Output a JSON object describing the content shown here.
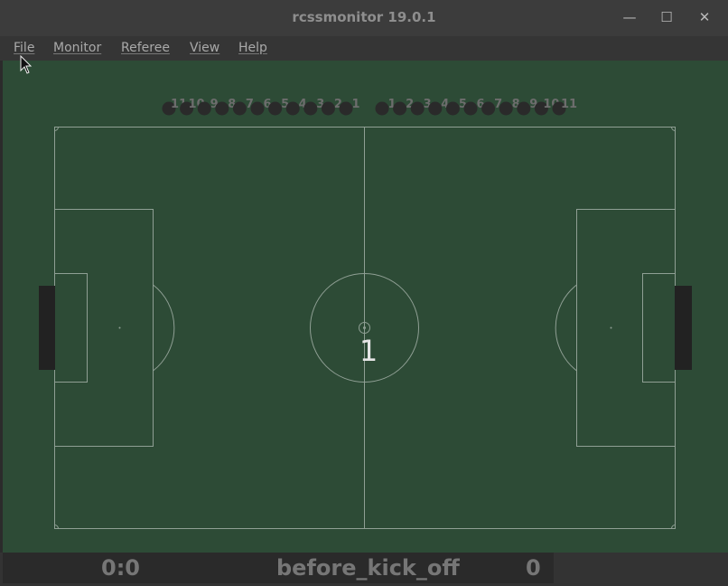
{
  "window": {
    "title": "rcssmonitor 19.0.1"
  },
  "controls": {
    "minimize": "—",
    "maximize": "☐",
    "close": "✕"
  },
  "menu": {
    "file": "File",
    "monitor": "Monitor",
    "referee": "Referee",
    "view": "View",
    "help": "Help"
  },
  "field": {
    "center_number": "1"
  },
  "teams": {
    "left_labels": [
      "11",
      "10",
      "9",
      "8",
      "7",
      "6",
      "5",
      "4",
      "3",
      "2",
      "1"
    ],
    "right_labels": [
      "1",
      "2",
      "3",
      "4",
      "5",
      "6",
      "7",
      "8",
      "9",
      "10",
      "11"
    ],
    "player_color": "#2a2a2a"
  },
  "status": {
    "score": "0:0",
    "playmode": "before_kick_off",
    "time": "0"
  },
  "colors": {
    "pitch": "#2d4b36",
    "lines": "#8f9f94",
    "goal": "#222222"
  }
}
